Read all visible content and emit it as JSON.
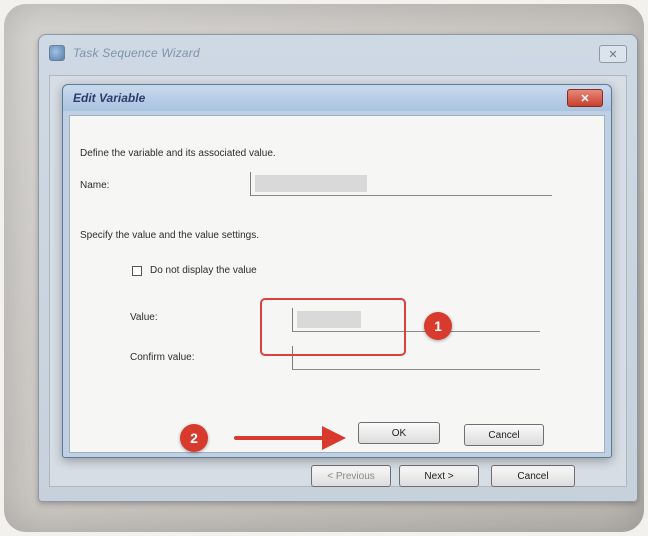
{
  "wizard": {
    "title": "Task Sequence Wizard",
    "close_label": "✕",
    "previous_label": "< Previous",
    "next_label": "Next >",
    "cancel_label": "Cancel"
  },
  "dialog": {
    "title": "Edit Variable",
    "close_label": "✕",
    "description": "Define the variable and its associated value.",
    "name_label": "Name:",
    "value_section": "Specify the value and the value settings.",
    "hide_value_label": "Do not display the value",
    "hide_value_checked": false,
    "value_label": "Value:",
    "confirm_label": "Confirm value:",
    "ok_label": "OK",
    "cancel_label": "Cancel"
  },
  "annotations": {
    "badge_1": "1",
    "badge_2": "2",
    "color": "#d93a2e"
  },
  "icons": {
    "wizard_app": "wizard-app-icon",
    "arrow": "arrow-right-icon"
  }
}
